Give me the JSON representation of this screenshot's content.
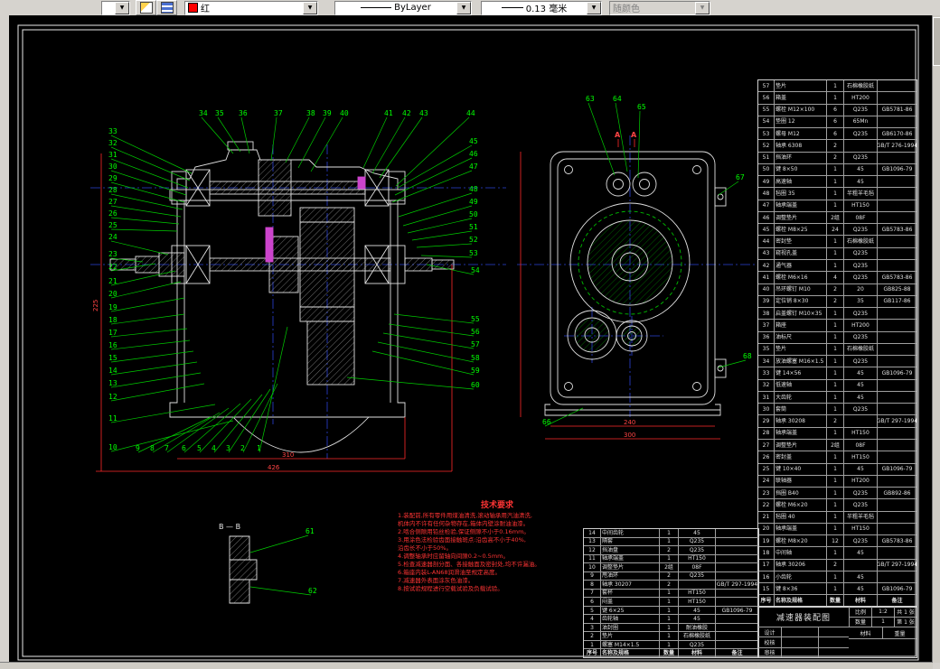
{
  "toolbar": {
    "layer_combo": {
      "value": ""
    },
    "color_combo": {
      "value": "红",
      "swatch": "#ff0000"
    },
    "linetype_combo": {
      "value": "ByLayer"
    },
    "lineweight_combo": {
      "value": "0.13 毫米"
    },
    "plotstyle_combo": {
      "value": "随颜色"
    }
  },
  "drawing": {
    "bb_label": "B — B",
    "aa_label": "A",
    "notes": {
      "title": "技术要求",
      "lines": [
        "1.装配前,所有零件用煤油清洗,滚动轴承用汽油清洗,",
        "  机体内不许有任何杂物存在,箱体内壁涂耐油油漆。",
        "2.啮合侧隙用铅丝检验,保证侧隙不小于0.16mm。",
        "3.用涂色法检验齿面接触斑点:沿齿高不小于40%,",
        "  沿齿长不小于50%。",
        "4.调整轴承时应留轴向间隙0.2~0.5mm。",
        "5.检查减速器剖分面、各接触面及密封处,均不许漏油。",
        "6.箱座内装L-AN68润滑油至规定高度。",
        "7.减速器外表面涂灰色油漆。",
        "8.按试验规程进行空载试验及负载试验。"
      ]
    },
    "dims": {
      "main_left": "225",
      "main_bottom_inner": "310",
      "main_bottom_outer": "426",
      "end_bottom_inner": "240",
      "end_bottom_outer": "300"
    },
    "callouts": [
      [
        34,
        220,
        126,
        258,
        170
      ],
      [
        35,
        238,
        126,
        266,
        168
      ],
      [
        36,
        264,
        126,
        276,
        170
      ],
      [
        37,
        303,
        126,
        300,
        178
      ],
      [
        38,
        339,
        126,
        316,
        180
      ],
      [
        39,
        357,
        126,
        330,
        186
      ],
      [
        40,
        376,
        126,
        344,
        190
      ],
      [
        41,
        425,
        126,
        402,
        186
      ],
      [
        42,
        445,
        126,
        412,
        192
      ],
      [
        43,
        464,
        126,
        420,
        197
      ],
      [
        44,
        516,
        126,
        438,
        206
      ],
      [
        33,
        120,
        146,
        212,
        192
      ],
      [
        32,
        120,
        159,
        210,
        200
      ],
      [
        31,
        120,
        172,
        208,
        208
      ],
      [
        30,
        120,
        185,
        206,
        216
      ],
      [
        29,
        120,
        198,
        204,
        224
      ],
      [
        28,
        120,
        211,
        202,
        232
      ],
      [
        27,
        120,
        224,
        200,
        240
      ],
      [
        26,
        120,
        237,
        198,
        248
      ],
      [
        25,
        120,
        250,
        196,
        256
      ],
      [
        24,
        120,
        263,
        186,
        282
      ],
      [
        23,
        120,
        282,
        158,
        290
      ],
      [
        22,
        120,
        296,
        172,
        292
      ],
      [
        21,
        120,
        312,
        194,
        300
      ],
      [
        20,
        120,
        326,
        200,
        312
      ],
      [
        19,
        120,
        341,
        204,
        330
      ],
      [
        18,
        120,
        355,
        204,
        348
      ],
      [
        17,
        120,
        369,
        207,
        364
      ],
      [
        16,
        120,
        383,
        210,
        377
      ],
      [
        15,
        120,
        397,
        214,
        389
      ],
      [
        14,
        120,
        411,
        218,
        401
      ],
      [
        13,
        120,
        425,
        222,
        413
      ],
      [
        12,
        120,
        440,
        226,
        425
      ],
      [
        11,
        120,
        464,
        238,
        448
      ],
      [
        10,
        120,
        496,
        258,
        466
      ],
      [
        9,
        150,
        497,
        233,
        462
      ],
      [
        8,
        166,
        497,
        243,
        457
      ],
      [
        7,
        182,
        497,
        253,
        452
      ],
      [
        6,
        201,
        497,
        266,
        447
      ],
      [
        5,
        218,
        497,
        278,
        442
      ],
      [
        4,
        234,
        497,
        290,
        437
      ],
      [
        3,
        250,
        497,
        299,
        431
      ],
      [
        2,
        266,
        497,
        307,
        425
      ],
      [
        1,
        284,
        497,
        318,
        362
      ],
      [
        45,
        519,
        157,
        440,
        208
      ],
      [
        46,
        519,
        171,
        437,
        216
      ],
      [
        47,
        519,
        185,
        434,
        224
      ],
      [
        48,
        519,
        210,
        441,
        240
      ],
      [
        49,
        519,
        224,
        446,
        250
      ],
      [
        50,
        519,
        238,
        451,
        258
      ],
      [
        51,
        519,
        252,
        456,
        266
      ],
      [
        52,
        519,
        266,
        461,
        274
      ],
      [
        53,
        519,
        281,
        466,
        283
      ],
      [
        54,
        521,
        300,
        472,
        293
      ],
      [
        55,
        521,
        354,
        436,
        348
      ],
      [
        56,
        521,
        368,
        430,
        359
      ],
      [
        57,
        521,
        382,
        424,
        369
      ],
      [
        58,
        521,
        397,
        418,
        379
      ],
      [
        59,
        521,
        411,
        412,
        389
      ],
      [
        60,
        521,
        427,
        384,
        418
      ],
      [
        61,
        338,
        589,
        277,
        612
      ],
      [
        62,
        341,
        655,
        277,
        650
      ],
      [
        63,
        648,
        110,
        680,
        194
      ],
      [
        64,
        678,
        110,
        694,
        190
      ],
      [
        65,
        705,
        119,
        706,
        197
      ],
      [
        66,
        600,
        468,
        645,
        452
      ],
      [
        67,
        814,
        197,
        795,
        216
      ],
      [
        68,
        822,
        395,
        795,
        407
      ]
    ]
  },
  "bom_main": {
    "headers": [
      "序号",
      "名称及规格",
      "数量",
      "材料",
      "备注"
    ],
    "rows": [
      [
        "57",
        "垫片",
        "1",
        "石棉橡胶纸",
        ""
      ],
      [
        "56",
        "箱盖",
        "1",
        "HT200",
        ""
      ],
      [
        "55",
        "螺栓 M12×100",
        "6",
        "Q235",
        "GB5781-86"
      ],
      [
        "54",
        "垫圈 12",
        "6",
        "65Mn",
        ""
      ],
      [
        "53",
        "螺母 M12",
        "6",
        "Q235",
        "GB6170-86"
      ],
      [
        "52",
        "轴承 6308",
        "2",
        "",
        "GB/T 276-1994"
      ],
      [
        "51",
        "挡油环",
        "2",
        "Q235",
        ""
      ],
      [
        "50",
        "键 8×50",
        "1",
        "45",
        "GB1096-79"
      ],
      [
        "49",
        "高速轴",
        "1",
        "45",
        ""
      ],
      [
        "48",
        "毡圈 35",
        "1",
        "半粗羊毛毡",
        ""
      ],
      [
        "47",
        "轴承端盖",
        "1",
        "HT150",
        ""
      ],
      [
        "46",
        "调整垫片",
        "2组",
        "08F",
        ""
      ],
      [
        "45",
        "螺栓 M8×25",
        "24",
        "Q235",
        "GB5783-86"
      ],
      [
        "44",
        "密封垫",
        "1",
        "石棉橡胶纸",
        ""
      ],
      [
        "43",
        "窥视孔盖",
        "1",
        "Q235",
        ""
      ],
      [
        "42",
        "通气器",
        "1",
        "Q235",
        ""
      ],
      [
        "41",
        "螺栓 M6×16",
        "4",
        "Q235",
        "GB5783-86"
      ],
      [
        "40",
        "吊环螺钉 M10",
        "2",
        "20",
        "GB825-88"
      ],
      [
        "39",
        "定位销 8×30",
        "2",
        "35",
        "GB117-86"
      ],
      [
        "38",
        "启盖螺钉 M10×35",
        "1",
        "Q235",
        ""
      ],
      [
        "37",
        "箱座",
        "1",
        "HT200",
        ""
      ],
      [
        "36",
        "油标尺",
        "1",
        "Q235",
        ""
      ],
      [
        "35",
        "垫片",
        "1",
        "石棉橡胶纸",
        ""
      ],
      [
        "34",
        "放油螺塞 M16×1.5",
        "1",
        "Q235",
        ""
      ],
      [
        "33",
        "键 14×56",
        "1",
        "45",
        "GB1096-79"
      ],
      [
        "32",
        "低速轴",
        "1",
        "45",
        ""
      ],
      [
        "31",
        "大齿轮",
        "1",
        "45",
        ""
      ],
      [
        "30",
        "套筒",
        "1",
        "Q235",
        ""
      ],
      [
        "29",
        "轴承 30208",
        "2",
        "",
        "GB/T 297-1994"
      ],
      [
        "28",
        "轴承端盖",
        "1",
        "HT150",
        ""
      ],
      [
        "27",
        "调整垫片",
        "2组",
        "08F",
        ""
      ],
      [
        "26",
        "密封盖",
        "1",
        "HT150",
        ""
      ],
      [
        "25",
        "键 10×40",
        "1",
        "45",
        "GB1096-79"
      ],
      [
        "24",
        "联轴器",
        "1",
        "HT200",
        ""
      ],
      [
        "23",
        "挡圈 B40",
        "1",
        "Q235",
        "GB892-86"
      ],
      [
        "22",
        "螺栓 M6×20",
        "1",
        "Q235",
        ""
      ],
      [
        "21",
        "毡圈 40",
        "1",
        "半粗羊毛毡",
        ""
      ],
      [
        "20",
        "轴承端盖",
        "1",
        "HT150",
        ""
      ],
      [
        "19",
        "螺栓 M8×20",
        "12",
        "Q235",
        "GB5783-86"
      ],
      [
        "18",
        "中间轴",
        "1",
        "45",
        ""
      ],
      [
        "17",
        "轴承 30206",
        "2",
        "",
        "GB/T 297-1994"
      ],
      [
        "16",
        "小齿轮",
        "1",
        "45",
        ""
      ],
      [
        "15",
        "键 8×36",
        "1",
        "45",
        "GB1096-79"
      ]
    ]
  },
  "bom_left": {
    "headers": [
      "序号",
      "名称及规格",
      "数量",
      "材料",
      "备注"
    ],
    "rows": [
      [
        "14",
        "中间齿轮",
        "1",
        "45",
        ""
      ],
      [
        "13",
        "隔套",
        "1",
        "Q235",
        ""
      ],
      [
        "12",
        "挡油盘",
        "2",
        "Q235",
        ""
      ],
      [
        "11",
        "轴承端盖",
        "1",
        "HT150",
        ""
      ],
      [
        "10",
        "调整垫片",
        "2组",
        "08F",
        ""
      ],
      [
        "9",
        "甩油环",
        "2",
        "Q235",
        ""
      ],
      [
        "8",
        "轴承 30207",
        "2",
        "",
        "GB/T 297-1994"
      ],
      [
        "7",
        "套杯",
        "1",
        "HT150",
        ""
      ],
      [
        "6",
        "闷盖",
        "1",
        "HT150",
        ""
      ],
      [
        "5",
        "键 6×25",
        "1",
        "45",
        "GB1096-79"
      ],
      [
        "4",
        "齿轮轴",
        "1",
        "45",
        ""
      ],
      [
        "3",
        "油封圈",
        "1",
        "耐油橡胶",
        ""
      ],
      [
        "2",
        "垫片",
        "1",
        "石棉橡胶纸",
        ""
      ],
      [
        "1",
        "螺塞 M14×1.5",
        "1",
        "Q235",
        ""
      ]
    ]
  },
  "titleblock": {
    "title": "减速器装配图",
    "scale_label": "比例",
    "scale": "1:2",
    "qty_label": "数量",
    "qty": "1",
    "sheet1": "共 1 张",
    "sheet2": "第 1 张",
    "material_label": "材料",
    "weight_label": "重量",
    "design_label": "设计",
    "check_label": "校核",
    "audit_label": "审核"
  }
}
